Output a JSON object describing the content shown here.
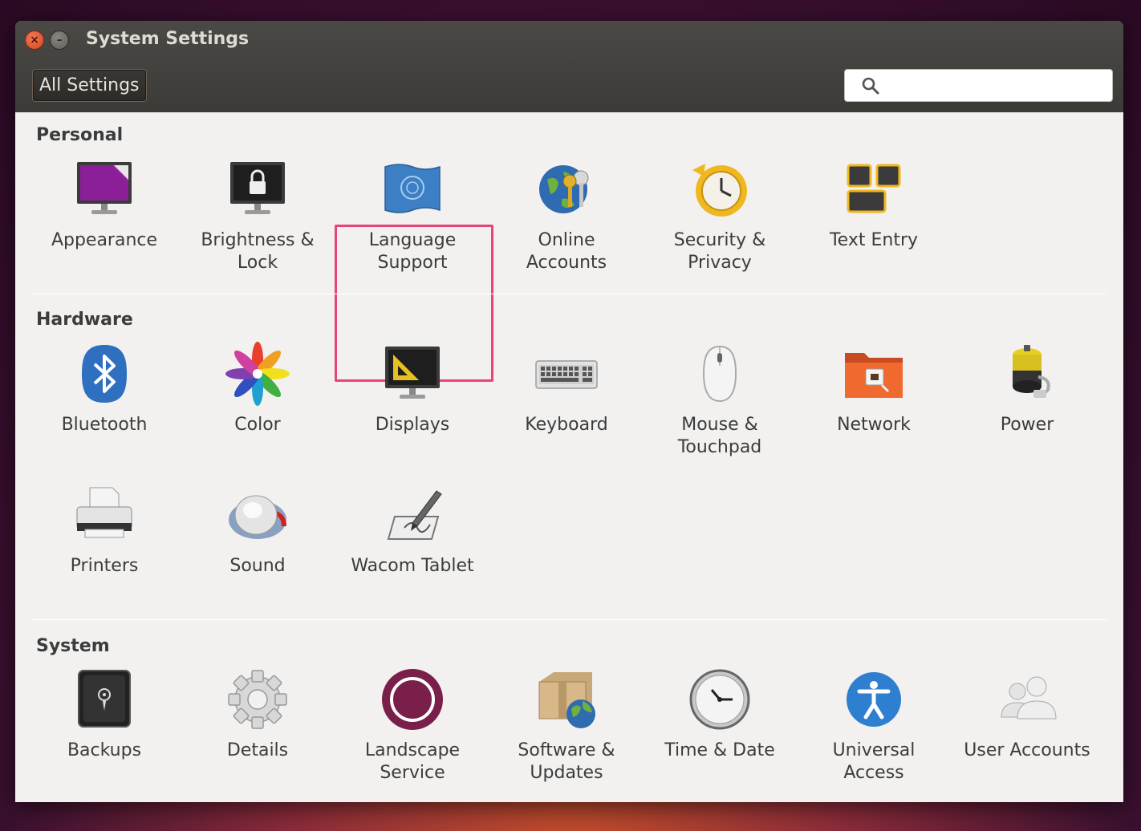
{
  "window": {
    "title": "System Settings"
  },
  "toolbar": {
    "all_settings_label": "All Settings",
    "search_placeholder": ""
  },
  "sections": {
    "personal": {
      "title": "Personal"
    },
    "hardware": {
      "title": "Hardware"
    },
    "system": {
      "title": "System"
    }
  },
  "items": {
    "appearance": "Appearance",
    "brightness": "Brightness &\nLock",
    "language": "Language\nSupport",
    "online_accounts": "Online\nAccounts",
    "security": "Security &\nPrivacy",
    "text_entry": "Text Entry",
    "bluetooth": "Bluetooth",
    "color": "Color",
    "displays": "Displays",
    "keyboard": "Keyboard",
    "mouse": "Mouse &\nTouchpad",
    "network": "Network",
    "power": "Power",
    "printers": "Printers",
    "sound": "Sound",
    "wacom": "Wacom Tablet",
    "backups": "Backups",
    "details": "Details",
    "landscape": "Landscape\nService",
    "software": "Software &\nUpdates",
    "time": "Time & Date",
    "universal": "Universal\nAccess",
    "users": "User Accounts"
  },
  "colors": {
    "highlight": "#e8437a",
    "accent": "#dd4814",
    "bluetooth": "#2e6fc0",
    "landscape": "#7a1f4a"
  }
}
